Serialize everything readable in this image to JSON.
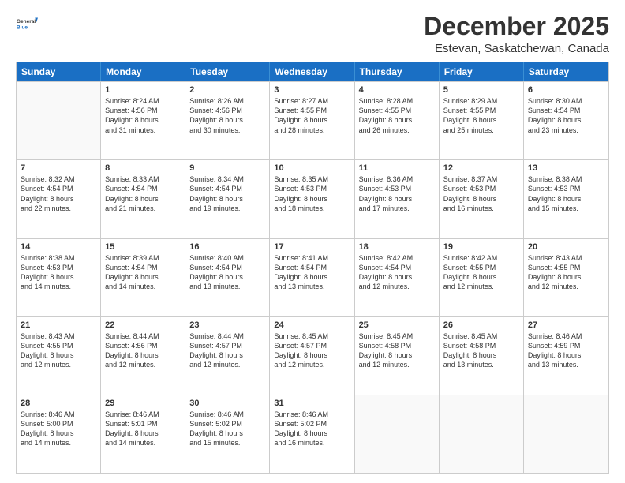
{
  "logo": {
    "line1": "General",
    "line2": "Blue"
  },
  "title": "December 2025",
  "location": "Estevan, Saskatchewan, Canada",
  "days_of_week": [
    "Sunday",
    "Monday",
    "Tuesday",
    "Wednesday",
    "Thursday",
    "Friday",
    "Saturday"
  ],
  "weeks": [
    [
      {
        "day": "",
        "lines": []
      },
      {
        "day": "1",
        "lines": [
          "Sunrise: 8:24 AM",
          "Sunset: 4:56 PM",
          "Daylight: 8 hours",
          "and 31 minutes."
        ]
      },
      {
        "day": "2",
        "lines": [
          "Sunrise: 8:26 AM",
          "Sunset: 4:56 PM",
          "Daylight: 8 hours",
          "and 30 minutes."
        ]
      },
      {
        "day": "3",
        "lines": [
          "Sunrise: 8:27 AM",
          "Sunset: 4:55 PM",
          "Daylight: 8 hours",
          "and 28 minutes."
        ]
      },
      {
        "day": "4",
        "lines": [
          "Sunrise: 8:28 AM",
          "Sunset: 4:55 PM",
          "Daylight: 8 hours",
          "and 26 minutes."
        ]
      },
      {
        "day": "5",
        "lines": [
          "Sunrise: 8:29 AM",
          "Sunset: 4:55 PM",
          "Daylight: 8 hours",
          "and 25 minutes."
        ]
      },
      {
        "day": "6",
        "lines": [
          "Sunrise: 8:30 AM",
          "Sunset: 4:54 PM",
          "Daylight: 8 hours",
          "and 23 minutes."
        ]
      }
    ],
    [
      {
        "day": "7",
        "lines": [
          "Sunrise: 8:32 AM",
          "Sunset: 4:54 PM",
          "Daylight: 8 hours",
          "and 22 minutes."
        ]
      },
      {
        "day": "8",
        "lines": [
          "Sunrise: 8:33 AM",
          "Sunset: 4:54 PM",
          "Daylight: 8 hours",
          "and 21 minutes."
        ]
      },
      {
        "day": "9",
        "lines": [
          "Sunrise: 8:34 AM",
          "Sunset: 4:54 PM",
          "Daylight: 8 hours",
          "and 19 minutes."
        ]
      },
      {
        "day": "10",
        "lines": [
          "Sunrise: 8:35 AM",
          "Sunset: 4:53 PM",
          "Daylight: 8 hours",
          "and 18 minutes."
        ]
      },
      {
        "day": "11",
        "lines": [
          "Sunrise: 8:36 AM",
          "Sunset: 4:53 PM",
          "Daylight: 8 hours",
          "and 17 minutes."
        ]
      },
      {
        "day": "12",
        "lines": [
          "Sunrise: 8:37 AM",
          "Sunset: 4:53 PM",
          "Daylight: 8 hours",
          "and 16 minutes."
        ]
      },
      {
        "day": "13",
        "lines": [
          "Sunrise: 8:38 AM",
          "Sunset: 4:53 PM",
          "Daylight: 8 hours",
          "and 15 minutes."
        ]
      }
    ],
    [
      {
        "day": "14",
        "lines": [
          "Sunrise: 8:38 AM",
          "Sunset: 4:53 PM",
          "Daylight: 8 hours",
          "and 14 minutes."
        ]
      },
      {
        "day": "15",
        "lines": [
          "Sunrise: 8:39 AM",
          "Sunset: 4:54 PM",
          "Daylight: 8 hours",
          "and 14 minutes."
        ]
      },
      {
        "day": "16",
        "lines": [
          "Sunrise: 8:40 AM",
          "Sunset: 4:54 PM",
          "Daylight: 8 hours",
          "and 13 minutes."
        ]
      },
      {
        "day": "17",
        "lines": [
          "Sunrise: 8:41 AM",
          "Sunset: 4:54 PM",
          "Daylight: 8 hours",
          "and 13 minutes."
        ]
      },
      {
        "day": "18",
        "lines": [
          "Sunrise: 8:42 AM",
          "Sunset: 4:54 PM",
          "Daylight: 8 hours",
          "and 12 minutes."
        ]
      },
      {
        "day": "19",
        "lines": [
          "Sunrise: 8:42 AM",
          "Sunset: 4:55 PM",
          "Daylight: 8 hours",
          "and 12 minutes."
        ]
      },
      {
        "day": "20",
        "lines": [
          "Sunrise: 8:43 AM",
          "Sunset: 4:55 PM",
          "Daylight: 8 hours",
          "and 12 minutes."
        ]
      }
    ],
    [
      {
        "day": "21",
        "lines": [
          "Sunrise: 8:43 AM",
          "Sunset: 4:55 PM",
          "Daylight: 8 hours",
          "and 12 minutes."
        ]
      },
      {
        "day": "22",
        "lines": [
          "Sunrise: 8:44 AM",
          "Sunset: 4:56 PM",
          "Daylight: 8 hours",
          "and 12 minutes."
        ]
      },
      {
        "day": "23",
        "lines": [
          "Sunrise: 8:44 AM",
          "Sunset: 4:57 PM",
          "Daylight: 8 hours",
          "and 12 minutes."
        ]
      },
      {
        "day": "24",
        "lines": [
          "Sunrise: 8:45 AM",
          "Sunset: 4:57 PM",
          "Daylight: 8 hours",
          "and 12 minutes."
        ]
      },
      {
        "day": "25",
        "lines": [
          "Sunrise: 8:45 AM",
          "Sunset: 4:58 PM",
          "Daylight: 8 hours",
          "and 12 minutes."
        ]
      },
      {
        "day": "26",
        "lines": [
          "Sunrise: 8:45 AM",
          "Sunset: 4:58 PM",
          "Daylight: 8 hours",
          "and 13 minutes."
        ]
      },
      {
        "day": "27",
        "lines": [
          "Sunrise: 8:46 AM",
          "Sunset: 4:59 PM",
          "Daylight: 8 hours",
          "and 13 minutes."
        ]
      }
    ],
    [
      {
        "day": "28",
        "lines": [
          "Sunrise: 8:46 AM",
          "Sunset: 5:00 PM",
          "Daylight: 8 hours",
          "and 14 minutes."
        ]
      },
      {
        "day": "29",
        "lines": [
          "Sunrise: 8:46 AM",
          "Sunset: 5:01 PM",
          "Daylight: 8 hours",
          "and 14 minutes."
        ]
      },
      {
        "day": "30",
        "lines": [
          "Sunrise: 8:46 AM",
          "Sunset: 5:02 PM",
          "Daylight: 8 hours",
          "and 15 minutes."
        ]
      },
      {
        "day": "31",
        "lines": [
          "Sunrise: 8:46 AM",
          "Sunset: 5:02 PM",
          "Daylight: 8 hours",
          "and 16 minutes."
        ]
      },
      {
        "day": "",
        "lines": []
      },
      {
        "day": "",
        "lines": []
      },
      {
        "day": "",
        "lines": []
      }
    ]
  ]
}
